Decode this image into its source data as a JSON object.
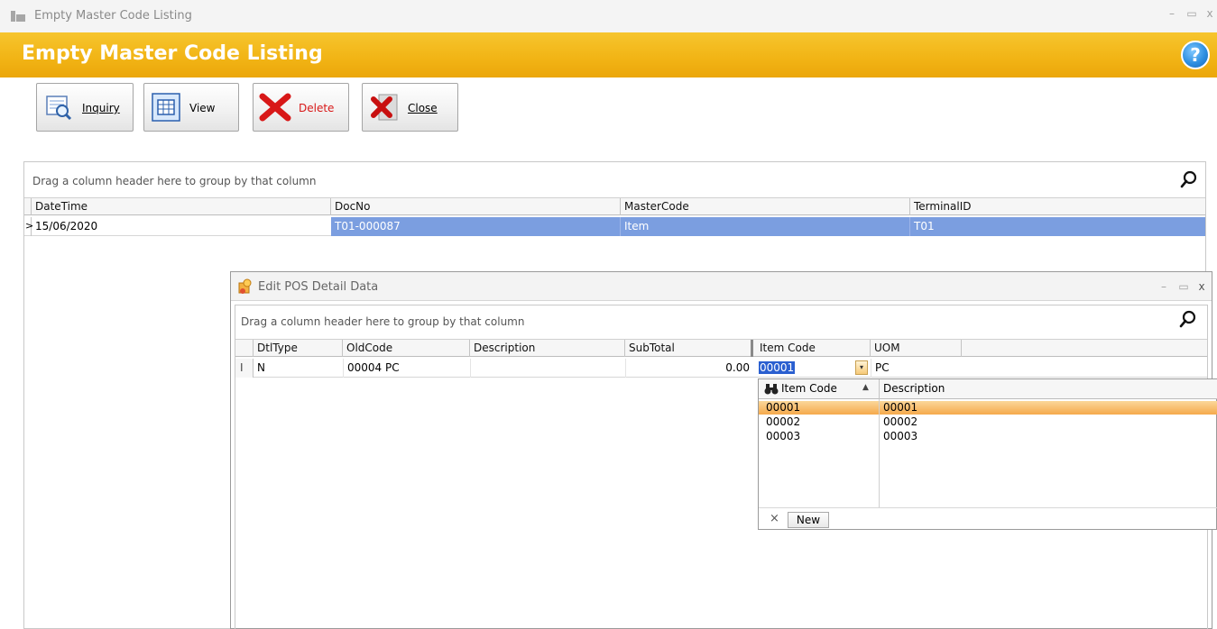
{
  "window": {
    "title": "Empty Master Code Listing",
    "minimize": "–",
    "maximize": "▭",
    "close": "x"
  },
  "header": {
    "title": "Empty Master Code Listing",
    "help": "?"
  },
  "toolbar": {
    "inquiry": "Inquiry",
    "view": "View",
    "delete": "Delete",
    "close": "Close"
  },
  "main_grid": {
    "group_hint": "Drag a column header here to group by that column",
    "columns": [
      "DateTime",
      "DocNo",
      "MasterCode",
      "TerminalID"
    ],
    "rows": [
      {
        "indicator": ">",
        "datetime": "15/06/2020",
        "docno": "T01-000087",
        "mastercode": "Item",
        "terminalid": "T01"
      }
    ]
  },
  "dialog": {
    "title": "Edit POS Detail Data",
    "minimize": "–",
    "maximize": "▭",
    "close": "x",
    "group_hint": "Drag a column header here to group by that column",
    "columns": [
      "DtlType",
      "OldCode",
      "Description",
      "SubTotal",
      "Item Code",
      "UOM"
    ],
    "rows": [
      {
        "indicator": "I",
        "dtltype": "N",
        "oldcode": "00004 PC",
        "description": "",
        "subtotal": "0.00",
        "itemcode": "00001",
        "uom": "PC"
      }
    ]
  },
  "lookup": {
    "columns": [
      "Item Code",
      "Description"
    ],
    "sort_glyph": "▲",
    "rows": [
      {
        "code": "00001",
        "description": "00001"
      },
      {
        "code": "00002",
        "description": "00002"
      },
      {
        "code": "00003",
        "description": "00003"
      }
    ],
    "clear_glyph": "×",
    "new_label": "New"
  },
  "colors": {
    "header_band": "#f2b516",
    "selection_blue": "#7b9ee0",
    "lookup_highlight": "#f7b15c"
  }
}
